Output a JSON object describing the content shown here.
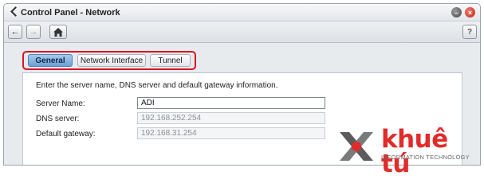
{
  "window": {
    "title": "Control Panel - Network"
  },
  "toolbar": {
    "back_icon": "arrow-left-icon",
    "forward_icon": "arrow-right-icon",
    "home_icon": "home-icon",
    "help_label": "?"
  },
  "tabs": [
    {
      "label": "General",
      "active": true
    },
    {
      "label": "Network Interface",
      "active": false
    },
    {
      "label": "Tunnel",
      "active": false
    }
  ],
  "general": {
    "description": "Enter the server name, DNS server and default gateway information.",
    "server_name": {
      "label": "Server Name:",
      "value": "ADI"
    },
    "dns_server": {
      "label": "DNS server:",
      "value": "192.168.252.254"
    },
    "default_gateway": {
      "label": "Default gateway:",
      "value": "192.168.31.254"
    }
  },
  "watermark": {
    "brand": "khuê tú",
    "tagline": "INFORMATION TECHNOLOGY"
  },
  "colors": {
    "highlight": "#d8162a",
    "active_tab": "#6d9fd4",
    "close_button": "#c0281a",
    "brand_red": "#e22b2b"
  }
}
